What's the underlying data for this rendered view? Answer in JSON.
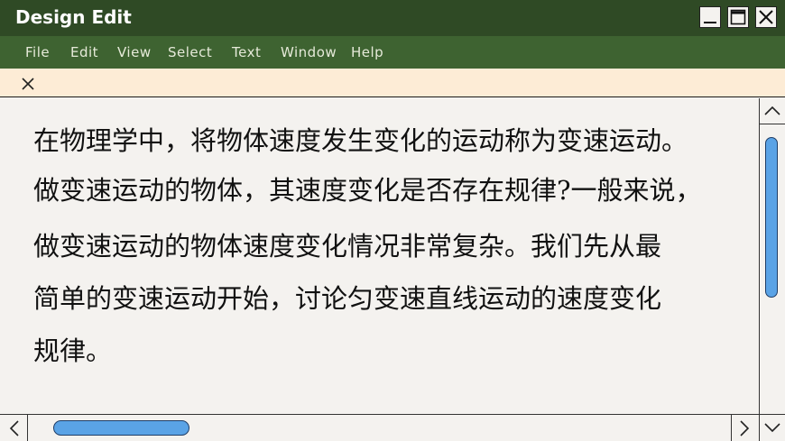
{
  "window": {
    "title": "Design Edit"
  },
  "menu": [
    "File",
    "Edit",
    "View",
    "Select",
    "Text",
    "Window",
    "Help"
  ],
  "document": {
    "lines": [
      "在物理学中，将物体速度发生变化的运动称为变速运动。",
      "做变速运动的物体，其速度变化是否存在规律?一般来说，",
      "做变速运动的物体速度变化情况非常复杂。我们先从最",
      "简单的变速运动开始，讨论匀变速直线运动的速度变化",
      "规律。"
    ]
  },
  "colors": {
    "titlebar": "#2f4a25",
    "menubar": "#3e6331",
    "tabstrip": "#fdecd6",
    "scroll_thumb": "#5aa3e6"
  },
  "icons": [
    "minimize-icon",
    "maximize-icon",
    "close-icon",
    "tab-close-icon",
    "scroll-up-icon",
    "scroll-down-icon",
    "scroll-left-icon",
    "scroll-right-icon"
  ]
}
